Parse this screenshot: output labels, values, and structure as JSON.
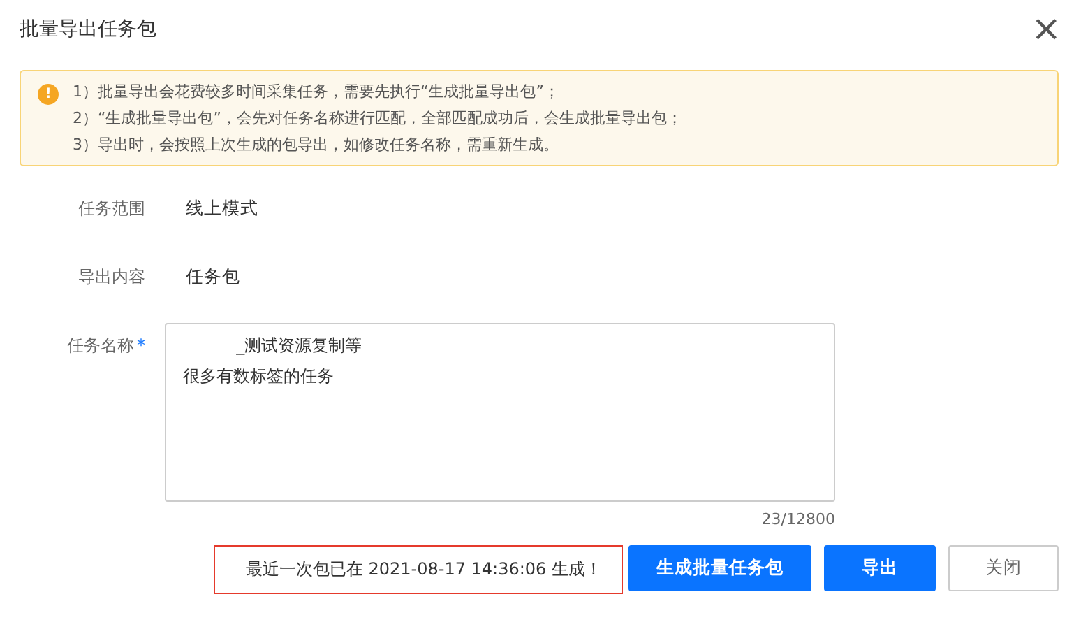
{
  "dialog": {
    "title": "批量导出任务包",
    "close": "×"
  },
  "notice": {
    "icon": "!",
    "lines": [
      "1）批量导出会花费较多时间采集任务，需要先执行“生成批量导出包”；",
      "2）“生成批量导出包”，会先对任务名称进行匹配，全部匹配成功后，会生成批量导出包；",
      "3）导出时，会按照上次生成的包导出，如修改任务名称，需重新生成。"
    ]
  },
  "fields": [
    {
      "kind": "text",
      "label": "任务范围",
      "value": "线上模式",
      "required": false
    },
    {
      "kind": "text",
      "label": "导出内容",
      "value": "任务包",
      "required": false
    },
    {
      "kind": "textarea",
      "label": "任务名称",
      "lines": [
        "          _测试资源复制等",
        "很多有数标签的任务"
      ],
      "required": true,
      "required_mark": "*",
      "counter": "23/12800"
    }
  ],
  "footer": {
    "status": "最近一次包已在 2021-08-17 14:36:06 生成！",
    "buttons": [
      {
        "label": "生成批量任务包",
        "kind": "primary"
      },
      {
        "label": "导出",
        "kind": "primary"
      },
      {
        "label": "关闭",
        "kind": "default"
      }
    ]
  }
}
